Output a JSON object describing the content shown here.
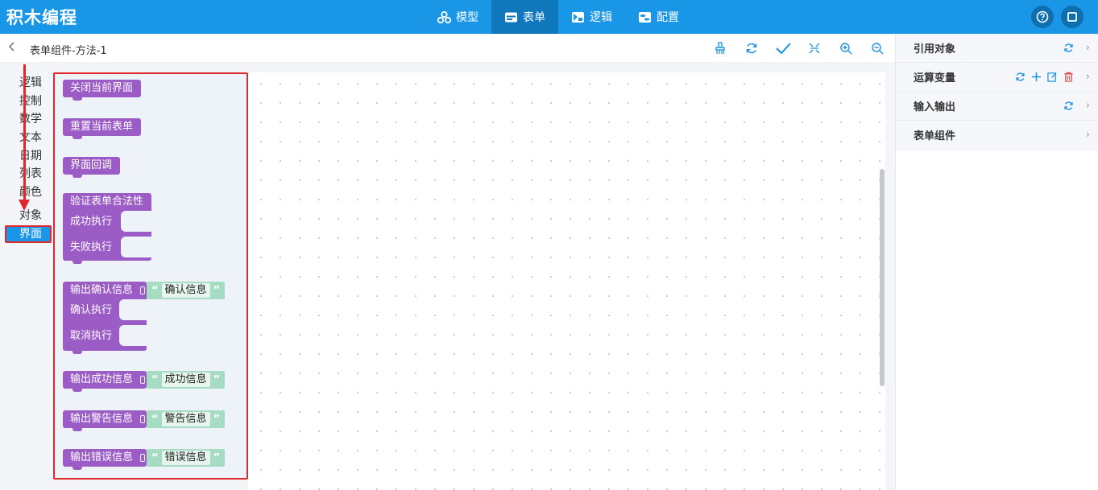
{
  "app": {
    "title": "积木编程"
  },
  "nav": [
    {
      "label": "模型",
      "icon": "cluster-icon"
    },
    {
      "label": "表单",
      "icon": "form-icon",
      "active": true
    },
    {
      "label": "逻辑",
      "icon": "logic-icon"
    },
    {
      "label": "配置",
      "icon": "config-icon"
    }
  ],
  "header_right": {
    "help_icon": "help-icon",
    "window_icon": "window-icon"
  },
  "breadcrumb": {
    "title": "表单组件-方法-1"
  },
  "toolbar": [
    "clean-icon",
    "refresh-icon",
    "check-icon",
    "collapse-icon",
    "zoom-in-icon",
    "zoom-out-icon"
  ],
  "categories": [
    "逻辑",
    "控制",
    "数学",
    "文本",
    "日期",
    "列表",
    "颜色",
    "对象",
    "界面"
  ],
  "selected_category": "界面",
  "blocks": {
    "close_ui": "关闭当前界面",
    "reset_form": "重置当前表单",
    "ui_callback": "界面回调",
    "validate": {
      "title": "验证表单合法性",
      "success": "成功执行",
      "fail": "失败执行"
    },
    "confirm": {
      "title": "输出确认信息",
      "value": "确认信息",
      "ok": "确认执行",
      "cancel": "取消执行"
    },
    "success": {
      "title": "输出成功信息",
      "value": "成功信息"
    },
    "warning": {
      "title": "输出警告信息",
      "value": "警告信息"
    },
    "error": {
      "title": "输出错误信息",
      "value": "错误信息"
    },
    "quote_open": "“",
    "quote_close": "”"
  },
  "panel": [
    {
      "label": "引用对象",
      "actions": [
        "refresh-icon"
      ]
    },
    {
      "label": "运算变量",
      "actions": [
        "refresh-icon",
        "plus-icon",
        "edit-icon",
        "delete-icon"
      ]
    },
    {
      "label": "输入输出",
      "actions": [
        "refresh-icon"
      ]
    },
    {
      "label": "表单组件",
      "actions": []
    }
  ],
  "colors": {
    "header": "#1a96e6",
    "block": "#9b5cc6",
    "string": "#a5dcc3",
    "highlight": "#e0282c"
  }
}
